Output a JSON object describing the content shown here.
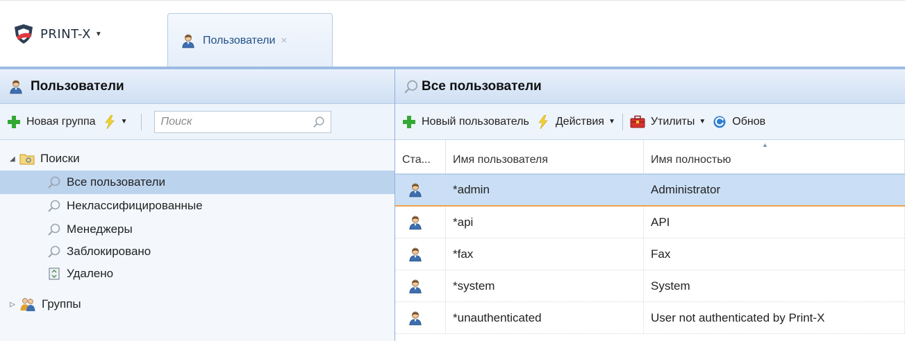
{
  "app": {
    "brand": "PRINT-X",
    "tab_label": "Пользователи",
    "tab_close": "×"
  },
  "left": {
    "title": "Пользователи",
    "new_group": "Новая группа",
    "search_placeholder": "Поиск",
    "tree": {
      "searches": "Поиски",
      "items": [
        "Все пользователи",
        "Неклассифицированные",
        "Менеджеры",
        "Заблокировано"
      ],
      "deleted": "Удалено",
      "groups": "Группы"
    }
  },
  "right": {
    "title": "Все пользователи",
    "toolbar": {
      "new_user": "Новый пользователь",
      "actions": "Действия",
      "utilities": "Утилиты",
      "refresh": "Обнов"
    },
    "columns": [
      "Ста...",
      "Имя пользователя",
      "Имя полностью"
    ],
    "rows": [
      {
        "username": "*admin",
        "fullname": "Administrator"
      },
      {
        "username": "*api",
        "fullname": "API"
      },
      {
        "username": "*fax",
        "fullname": "Fax"
      },
      {
        "username": "*system",
        "fullname": "System"
      },
      {
        "username": "*unauthenticated",
        "fullname": "User not authenticated by Print-X"
      }
    ]
  },
  "colors": {
    "accent": "#9cbbe3",
    "selection": "#cadff5",
    "selection_border": "#f0a24b"
  }
}
